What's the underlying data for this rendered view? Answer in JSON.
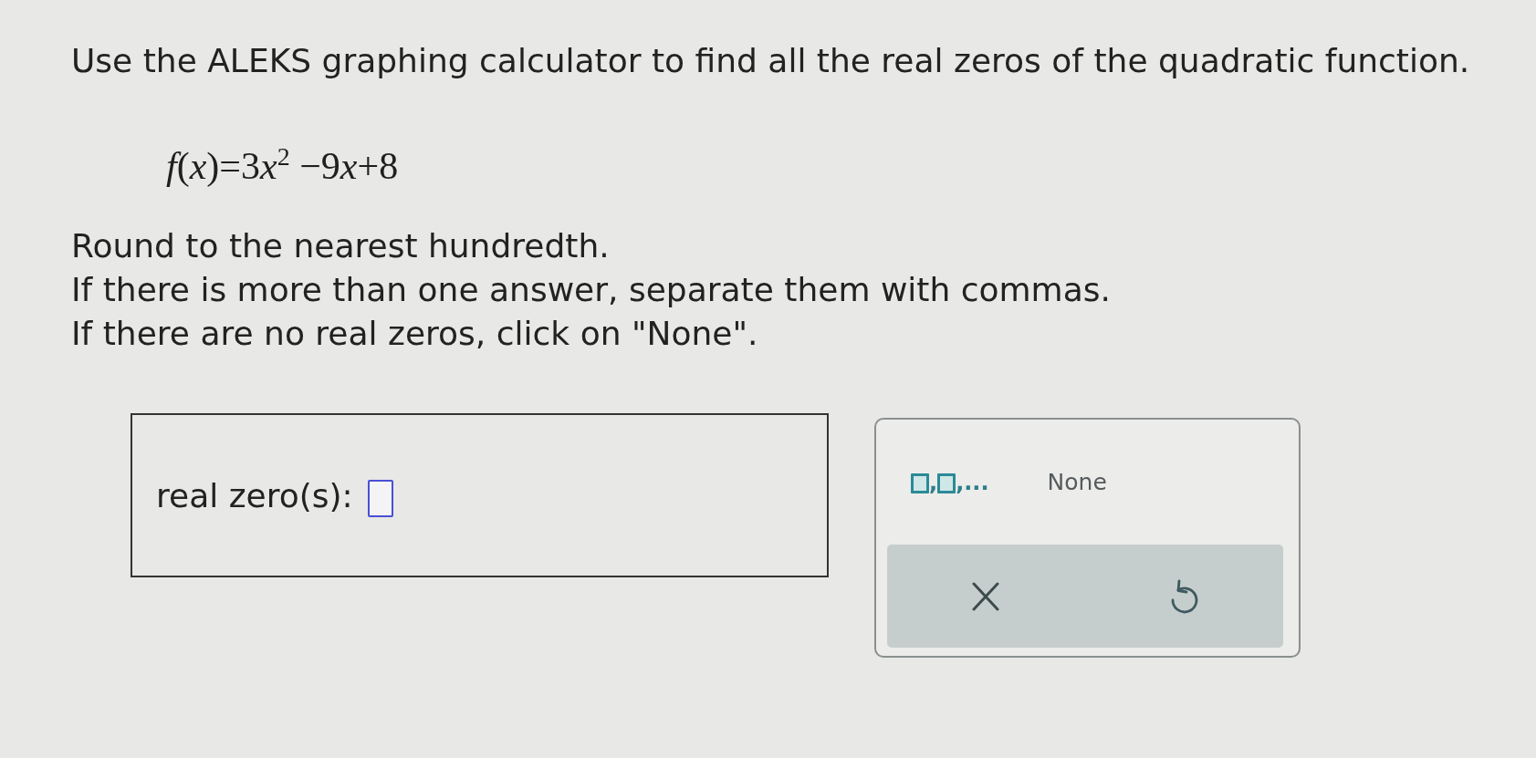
{
  "question": {
    "instruction": "Use the ALEKS graphing calculator to find all the real zeros of the quadratic function.",
    "formula_parts": [
      {
        "kind": "var",
        "text": "f"
      },
      {
        "kind": "plain",
        "text": "("
      },
      {
        "kind": "var",
        "text": "x"
      },
      {
        "kind": "plain",
        "text": ")=3"
      },
      {
        "kind": "var",
        "text": "x"
      },
      {
        "kind": "sup",
        "text": "2"
      },
      {
        "kind": "plain",
        "text": " −9"
      },
      {
        "kind": "var",
        "text": "x"
      },
      {
        "kind": "plain",
        "text": "+8"
      }
    ],
    "notes": [
      "Round to the nearest hundredth.",
      "If there is more than one answer, separate them with commas.",
      "If there are no real zeros, click on \"None\"."
    ]
  },
  "answer": {
    "label": "real zero(s):"
  },
  "keypad": {
    "template_parts": [
      {
        "kind": "box"
      },
      {
        "kind": "text",
        "text": ","
      },
      {
        "kind": "box"
      },
      {
        "kind": "text",
        "text": ",..."
      }
    ],
    "none_button": "None",
    "actions": [
      {
        "kind": "clear"
      },
      {
        "kind": "undo"
      }
    ]
  }
}
